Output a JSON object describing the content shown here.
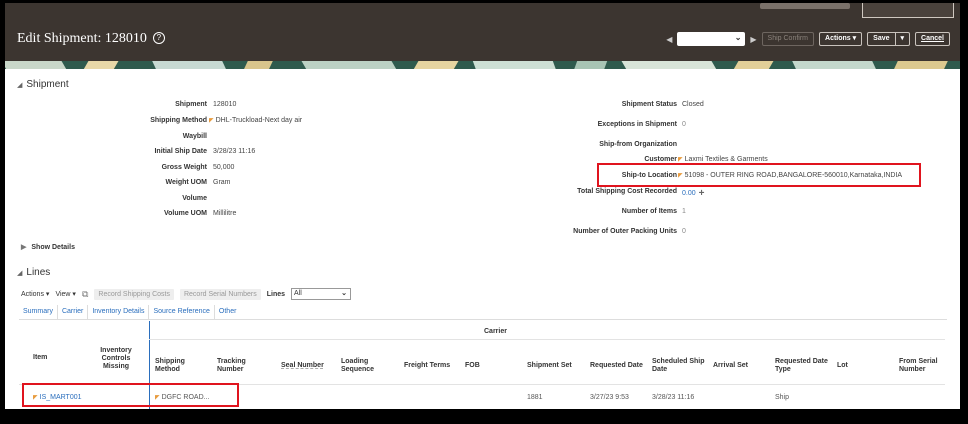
{
  "header": {
    "title": "Edit Shipment: 128010",
    "ship_confirm": "Ship Confirm",
    "actions": "Actions",
    "save": "Save",
    "cancel": "Cancel",
    "nav_select_value": ""
  },
  "sections": {
    "shipment": "Shipment",
    "lines": "Lines",
    "show_details": "Show Details"
  },
  "left_fields": [
    {
      "label": "Shipment",
      "value": "128010"
    },
    {
      "label": "Shipping Method",
      "value": "DHL-Truckload-Next day air"
    },
    {
      "label": "Waybill",
      "value": ""
    },
    {
      "label": "Initial Ship Date",
      "value": "3/28/23 11:16"
    },
    {
      "label": "Gross Weight",
      "value": "50,000"
    },
    {
      "label": "Weight UOM",
      "value": "Gram"
    },
    {
      "label": "Volume",
      "value": ""
    },
    {
      "label": "Volume UOM",
      "value": "Millilitre"
    }
  ],
  "right_fields": [
    {
      "label": "Shipment Status",
      "value": "Closed"
    },
    {
      "label": "Exceptions in Shipment",
      "value": "0"
    },
    {
      "label": "Ship-from Organization",
      "value": ""
    },
    {
      "label": "Customer",
      "value": "Laxmi Textiles & Garments"
    },
    {
      "label": "Ship-to Location",
      "value": "51098 - OUTER RING ROAD,BANGALORE-560010,Karnataka,INDIA"
    },
    {
      "label": "Total Shipping Cost Recorded",
      "value": "0.00"
    },
    {
      "label": "Number of Items",
      "value": "1"
    },
    {
      "label": "Number of Outer Packing Units",
      "value": "0"
    }
  ],
  "toolbar": {
    "actions": "Actions",
    "view": "View",
    "record_shipping_costs": "Record Shipping Costs",
    "record_serial_numbers": "Record Serial Numbers",
    "lines_label": "Lines",
    "lines_value": "All"
  },
  "tabs": [
    "Summary",
    "Carrier",
    "Inventory Details",
    "Source Reference",
    "Other"
  ],
  "grid": {
    "group_header": "Carrier",
    "columns": [
      "Item",
      "Inventory Controls Missing",
      "Shipping Method",
      "Tracking Number",
      "Seal Number",
      "Loading Sequence",
      "Freight Terms",
      "FOB",
      "Shipment Set",
      "Requested Date",
      "Scheduled Ship Date",
      "Arrival Set",
      "Requested Date Type",
      "Lot",
      "From Serial Number"
    ],
    "row": {
      "item": "IS_MART001",
      "shipping_method": "DGFC ROAD...",
      "shipment_set": "1881",
      "requested_date": "3/27/23 9:53",
      "scheduled_ship_date": "3/28/23 11:16",
      "requested_date_type": "Ship"
    }
  },
  "colors": {
    "header_bg": "#3c3530",
    "link": "#2a6ebd",
    "highlight_border": "#e0141e"
  }
}
